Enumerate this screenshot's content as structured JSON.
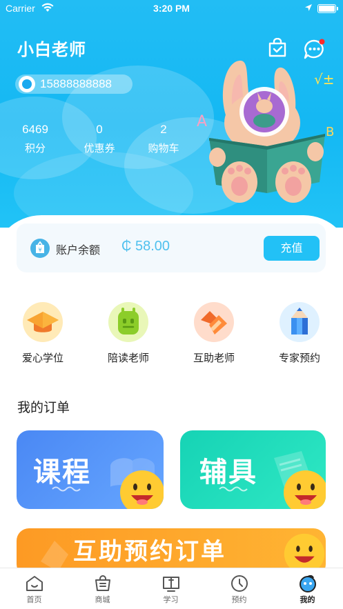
{
  "status_bar": {
    "carrier": "Carrier",
    "time": "3:20 PM"
  },
  "profile": {
    "name": "小白老师",
    "phone": "15888888888",
    "stats": [
      {
        "value": "6469",
        "label": "积分"
      },
      {
        "value": "0",
        "label": "优惠券"
      },
      {
        "value": "2",
        "label": "购物车"
      }
    ],
    "icons": [
      "bag-check-icon",
      "message-dots-icon"
    ],
    "notification_dot_color": "#ff2a2a"
  },
  "balance": {
    "label": "账户余额",
    "amount": "₵ 58.00",
    "recharge_label": "充值"
  },
  "features": [
    {
      "label": "爱心学位",
      "icon": "graduation-cap-icon"
    },
    {
      "label": "陪读老师",
      "icon": "robot-icon"
    },
    {
      "label": "互助老师",
      "icon": "heart-hands-icon"
    },
    {
      "label": "专家预约",
      "icon": "pencil-icon"
    }
  ],
  "orders": {
    "title": "我的订单",
    "cards": [
      {
        "label": "课程",
        "color": "#4b8df5"
      },
      {
        "label": "辅具",
        "color": "#19d6b8"
      },
      {
        "label": "互助预约订单",
        "color": "#fda22c"
      }
    ]
  },
  "tabbar": {
    "items": [
      {
        "label": "首页",
        "icon": "home-icon"
      },
      {
        "label": "商城",
        "icon": "shop-bag-icon"
      },
      {
        "label": "学习",
        "icon": "book-icon"
      },
      {
        "label": "预约",
        "icon": "clock-icon"
      },
      {
        "label": "我的",
        "icon": "profile-face-icon"
      }
    ],
    "active_index": 4
  },
  "colors": {
    "header": "#1ab9f4",
    "accent": "#22c1f6",
    "balance_text": "#4fc0ee"
  }
}
